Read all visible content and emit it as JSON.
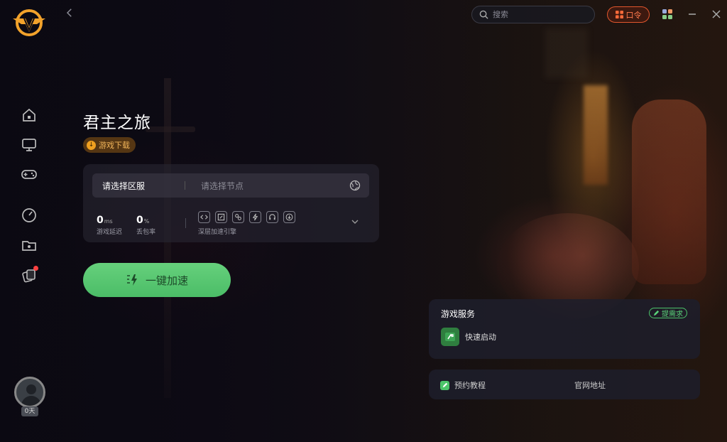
{
  "window": {
    "search_placeholder": "搜索",
    "kouling_label": "口令"
  },
  "sidebar": {
    "items": [
      {
        "name": "home"
      },
      {
        "name": "monitor"
      },
      {
        "name": "gamepad"
      },
      {
        "name": "speedometer"
      },
      {
        "name": "folder"
      },
      {
        "name": "cards",
        "has_badge": true
      }
    ],
    "avatar_days": "0天"
  },
  "game": {
    "title": "君主之旅",
    "download_label": "游戏下载"
  },
  "node_panel": {
    "region_placeholder": "请选择区服",
    "node_placeholder": "请选择节点",
    "latency_value": "0",
    "latency_unit": "ms",
    "latency_label": "游戏延迟",
    "loss_value": "0",
    "loss_unit": "%",
    "loss_label": "丢包率",
    "tools_label": "深层加速引擎"
  },
  "accelerate_label": "一键加速",
  "services": {
    "title": "游戏服务",
    "demand_label": "提需求",
    "quick_start_label": "快速启动"
  },
  "links": {
    "tutorial_label": "预约教程",
    "website_label": "官网地址"
  },
  "colors": {
    "accent_green": "#5ad27a",
    "accent_orange": "#ff7a4d",
    "download_gold": "#f2b55a"
  }
}
